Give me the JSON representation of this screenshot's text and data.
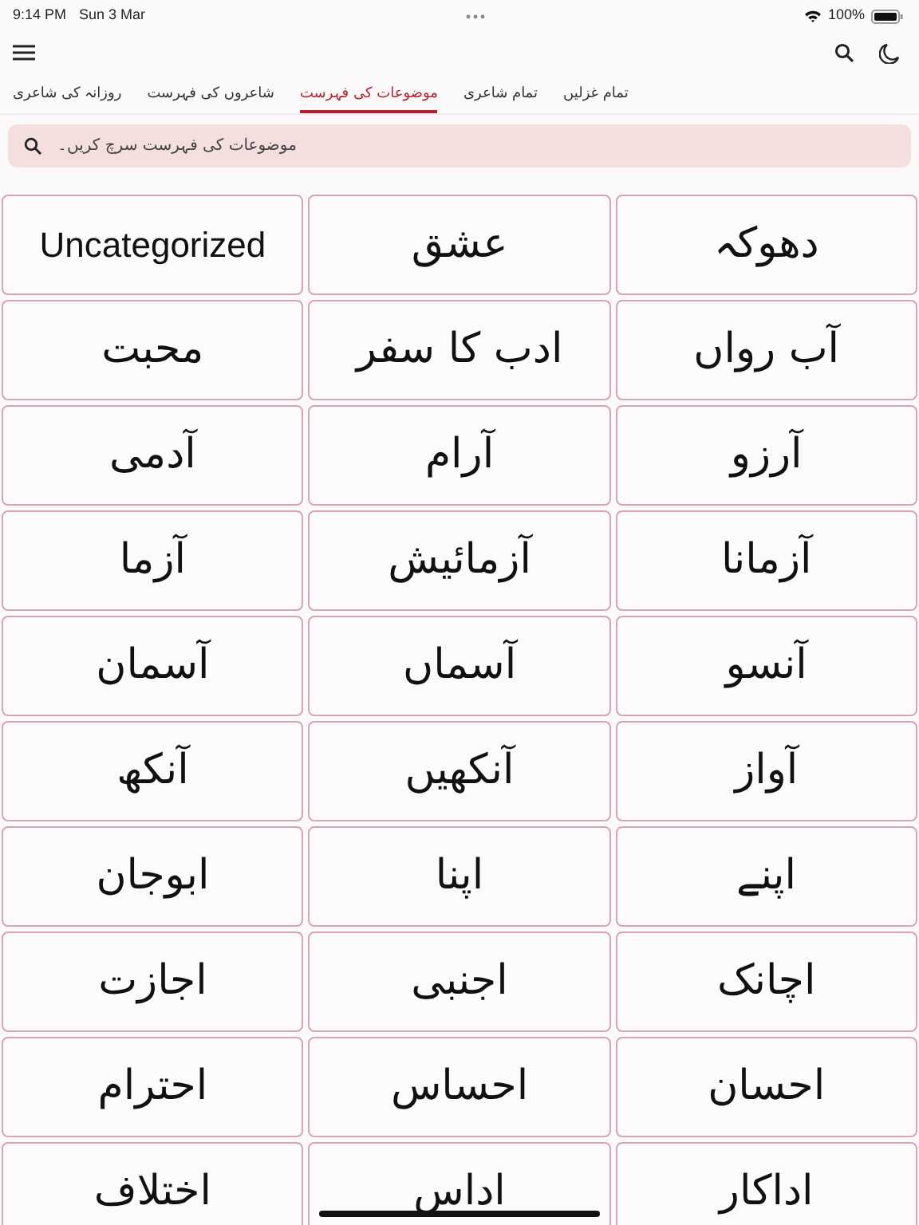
{
  "status_bar": {
    "time": "9:14 PM",
    "date": "Sun 3 Mar",
    "battery": "100%"
  },
  "tabs": [
    {
      "label": "تمام غزلیں",
      "selected": false
    },
    {
      "label": "تمام شاعری",
      "selected": false
    },
    {
      "label": "موضوعات کی فہرست",
      "selected": true
    },
    {
      "label": "شاعروں کی فہرست",
      "selected": false
    },
    {
      "label": "روزانہ کی شاعری",
      "selected": false
    }
  ],
  "search": {
    "placeholder": "موضوعات کی فہرست سرچ کریں۔"
  },
  "topics": [
    "دھوکہ",
    "عشق",
    "Uncategorized",
    "آب رواں",
    "ادب کا سفر",
    "محبت",
    "آرزو",
    "آرام",
    "آدمی",
    "آزمانا",
    "آزمائیش",
    "آزما",
    "آنسو",
    "آسماں",
    "آسمان",
    "آواز",
    "آنکھیں",
    "آنکھ",
    "اپنے",
    "اپنا",
    "ابوجان",
    "اچانک",
    "اجنبی",
    "اجازت",
    "احسان",
    "احساس",
    "احترام",
    "اداکار",
    "اداس",
    "اختلاف"
  ]
}
